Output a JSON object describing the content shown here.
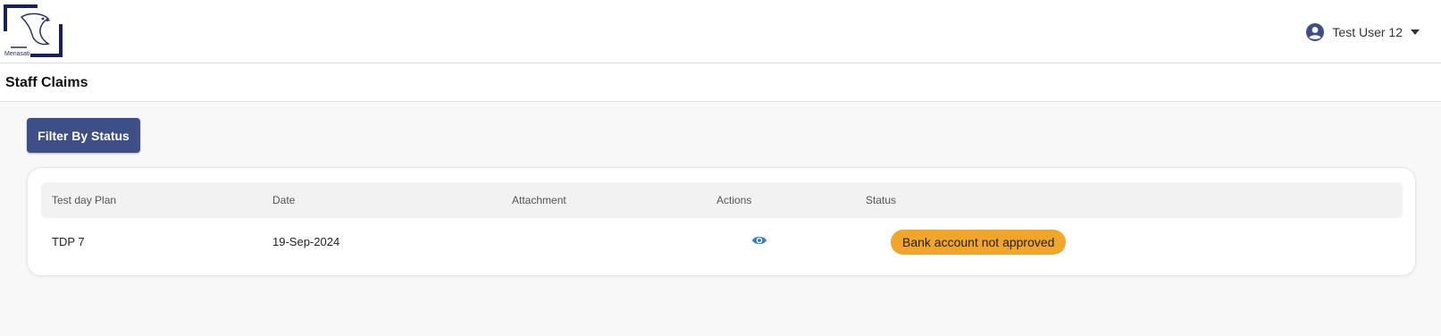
{
  "header": {
    "logo_text": "Menasati",
    "user_name": "Test User 12"
  },
  "page": {
    "title": "Staff Claims"
  },
  "toolbar": {
    "filter_label": "Filter By Status"
  },
  "table": {
    "columns": [
      "Test day Plan",
      "Date",
      "Attachment",
      "Actions",
      "Status"
    ],
    "rows": [
      {
        "plan": "TDP 7",
        "date": "19-Sep-2024",
        "attachment": "",
        "action_icon": "eye-icon",
        "status": "Bank account not approved"
      }
    ]
  },
  "colors": {
    "primary": "#3e4e86",
    "status_warning": "#f2a52b",
    "icon_blue": "#2f79d1"
  }
}
